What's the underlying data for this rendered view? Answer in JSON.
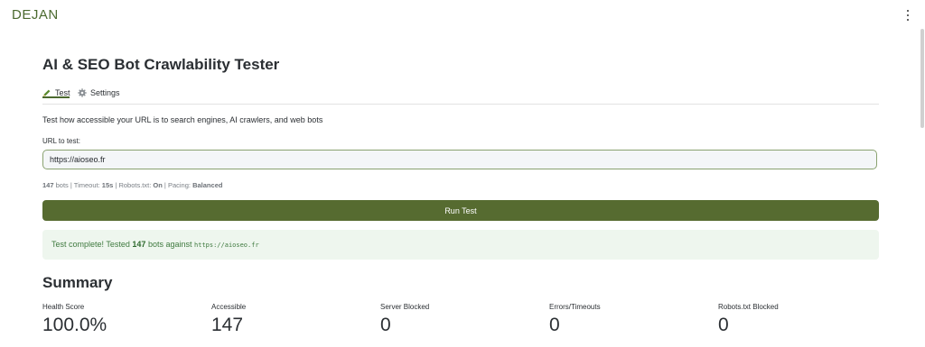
{
  "brand": {
    "logo_text": "DEJAN"
  },
  "header": {
    "title": "AI & SEO Bot Crawlability Tester"
  },
  "tabs": [
    {
      "label": "Test",
      "icon": "pencil-icon",
      "active": true
    },
    {
      "label": "Settings",
      "icon": "gear-icon",
      "active": false
    }
  ],
  "main": {
    "description": "Test how accessible your URL is to search engines, AI crawlers, and web bots",
    "url_label": "URL to test:",
    "url_value": "https://aioseo.fr",
    "meta": {
      "bots_count": "147",
      "bots_label": "bots",
      "timeout_label": "Timeout:",
      "timeout_value": "15s",
      "robots_label": "Robots.txt:",
      "robots_value": "On",
      "pacing_label": "Pacing:",
      "pacing_value": "Balanced",
      "separator": "|"
    },
    "run_button_label": "Run Test",
    "result": {
      "prefix": "Test complete! Tested",
      "count": "147",
      "middle": "bots against",
      "url": "https://aioseo.fr"
    }
  },
  "summary": {
    "title": "Summary",
    "stats": [
      {
        "label": "Health Score",
        "value": "100.0%"
      },
      {
        "label": "Accessible",
        "value": "147"
      },
      {
        "label": "Server Blocked",
        "value": "0"
      },
      {
        "label": "Errors/Timeouts",
        "value": "0"
      },
      {
        "label": "Robots.txt Blocked",
        "value": "0"
      }
    ]
  },
  "colors": {
    "accent": "#566b30",
    "brand": "#4b6a2f",
    "success_bg": "#eef6ee",
    "success_text": "#3f7a3f"
  }
}
